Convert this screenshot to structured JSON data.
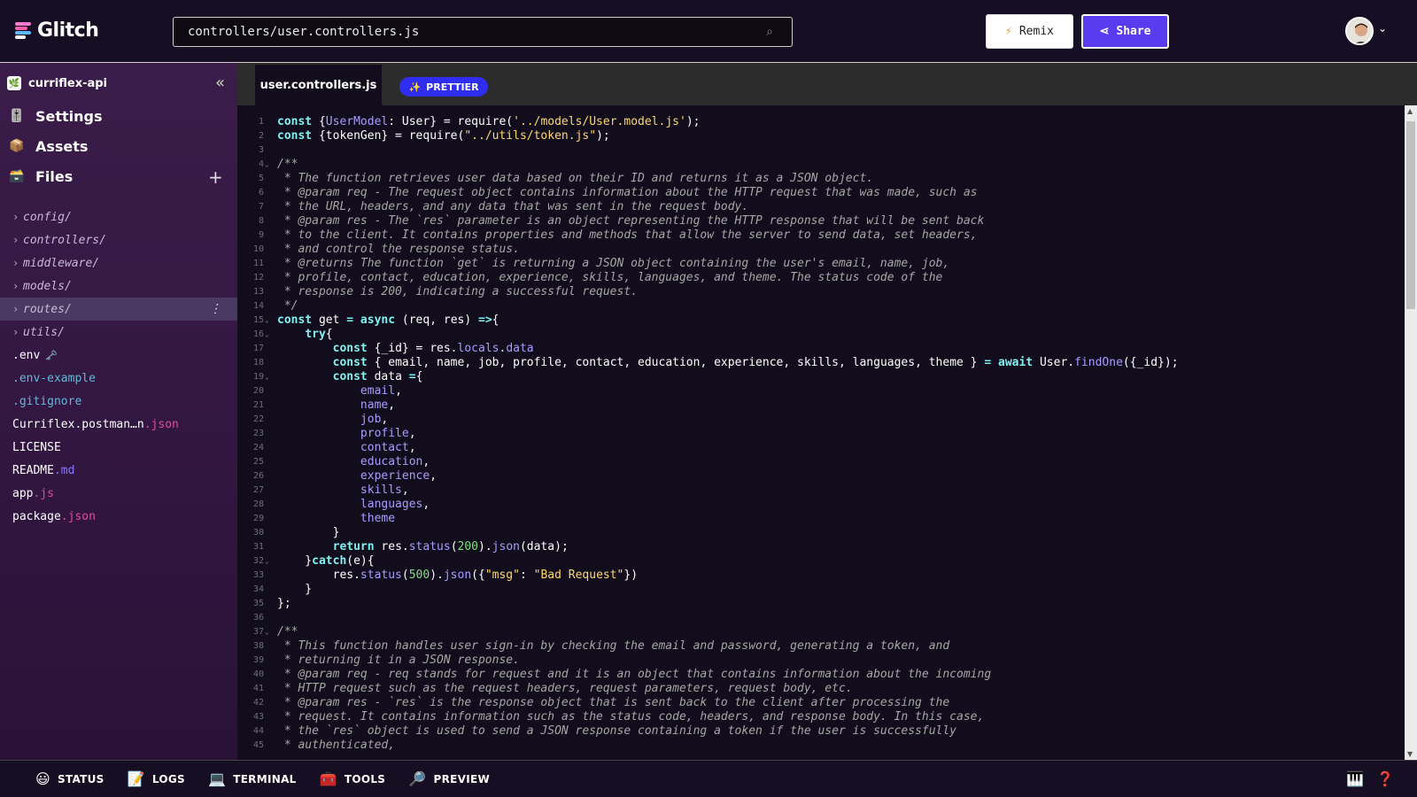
{
  "header": {
    "logo_text": "Glitch",
    "search_value": "controllers/user.controllers.js",
    "remix_label": "Remix",
    "share_label": "Share"
  },
  "sidebar": {
    "project_name": "curriflex-api",
    "nav": [
      {
        "label": "Settings",
        "icon": "settings-icon"
      },
      {
        "label": "Assets",
        "icon": "assets-icon"
      },
      {
        "label": "Files",
        "icon": "files-icon"
      }
    ],
    "files": [
      {
        "name": "config/",
        "type": "folder"
      },
      {
        "name": "controllers/",
        "type": "folder"
      },
      {
        "name": "middleware/",
        "type": "folder"
      },
      {
        "name": "models/",
        "type": "folder"
      },
      {
        "name": "routes/",
        "type": "folder",
        "selected": true
      },
      {
        "name": "utils/",
        "type": "folder"
      },
      {
        "name": ".env",
        "suffix": "🗝️",
        "type": "file"
      },
      {
        "name": ".env-example",
        "type": "file"
      },
      {
        "name": ".gitignore",
        "type": "file"
      },
      {
        "name": "Curriflex.postman…n",
        "ext": ".json",
        "type": "file"
      },
      {
        "name": "LICENSE",
        "type": "file"
      },
      {
        "name": "README",
        "ext": ".md",
        "type": "file"
      },
      {
        "name": "app",
        "ext": ".js",
        "type": "file"
      },
      {
        "name": "package",
        "ext": ".json",
        "type": "file"
      }
    ]
  },
  "editor": {
    "tab_label": "user.controllers.js",
    "prettier_label": "PRETTIER",
    "lines": [
      [
        [
          "kw",
          "const "
        ],
        [
          "pl",
          "{"
        ],
        [
          "prop",
          "UserModel"
        ],
        [
          "pl",
          ": User} = require("
        ],
        [
          "str",
          "'../models/User.model.js'"
        ],
        [
          "pl",
          ");"
        ]
      ],
      [
        [
          "kw",
          "const "
        ],
        [
          "pl",
          "{tokenGen} = require("
        ],
        [
          "str",
          "\"../utils/token.js\""
        ],
        [
          "pl",
          ");"
        ]
      ],
      [],
      [
        [
          "cm",
          "/**"
        ]
      ],
      [
        [
          "cm",
          " * The function retrieves user data based on their ID and returns it as a JSON object."
        ]
      ],
      [
        [
          "cm",
          " * @param req - The request object contains information about the HTTP request that was made, such as"
        ]
      ],
      [
        [
          "cm",
          " * the URL, headers, and any data that was sent in the request body."
        ]
      ],
      [
        [
          "cm",
          " * @param res - The `res` parameter is an object representing the HTTP response that will be sent back"
        ]
      ],
      [
        [
          "cm",
          " * to the client. It contains properties and methods that allow the server to send data, set headers,"
        ]
      ],
      [
        [
          "cm",
          " * and control the response status."
        ]
      ],
      [
        [
          "cm",
          " * @returns The function `get` is returning a JSON object containing the user's email, name, job,"
        ]
      ],
      [
        [
          "cm",
          " * profile, contact, education, experience, skills, languages, and theme. The status code of the"
        ]
      ],
      [
        [
          "cm",
          " * response is 200, indicating a successful request."
        ]
      ],
      [
        [
          "cm",
          " */"
        ]
      ],
      [
        [
          "kw",
          "const "
        ],
        [
          "pl",
          "get "
        ],
        [
          "kw",
          "= async "
        ],
        [
          "pl",
          "(req, res) "
        ],
        [
          "kw",
          "=>"
        ],
        [
          "pl",
          "{"
        ]
      ],
      [
        [
          "pl",
          "    "
        ],
        [
          "kw",
          "try"
        ],
        [
          "pl",
          "{"
        ]
      ],
      [
        [
          "pl",
          "        "
        ],
        [
          "kw",
          "const "
        ],
        [
          "pl",
          "{_id} = res."
        ],
        [
          "prop",
          "locals"
        ],
        [
          "pl",
          "."
        ],
        [
          "prop",
          "data"
        ]
      ],
      [
        [
          "pl",
          "        "
        ],
        [
          "kw",
          "const "
        ],
        [
          "pl",
          "{ email, name, job, profile, contact, education, experience, skills, languages, theme } "
        ],
        [
          "kw",
          "= await "
        ],
        [
          "pl",
          "User."
        ],
        [
          "prop",
          "findOne"
        ],
        [
          "pl",
          "({_id});"
        ]
      ],
      [
        [
          "pl",
          "        "
        ],
        [
          "kw",
          "const "
        ],
        [
          "pl",
          "data "
        ],
        [
          "kw",
          "="
        ],
        [
          "pl",
          "{"
        ]
      ],
      [
        [
          "pl",
          "            "
        ],
        [
          "prop",
          "email"
        ],
        [
          "pl",
          ","
        ]
      ],
      [
        [
          "pl",
          "            "
        ],
        [
          "prop",
          "name"
        ],
        [
          "pl",
          ","
        ]
      ],
      [
        [
          "pl",
          "            "
        ],
        [
          "prop",
          "job"
        ],
        [
          "pl",
          ","
        ]
      ],
      [
        [
          "pl",
          "            "
        ],
        [
          "prop",
          "profile"
        ],
        [
          "pl",
          ","
        ]
      ],
      [
        [
          "pl",
          "            "
        ],
        [
          "prop",
          "contact"
        ],
        [
          "pl",
          ","
        ]
      ],
      [
        [
          "pl",
          "            "
        ],
        [
          "prop",
          "education"
        ],
        [
          "pl",
          ","
        ]
      ],
      [
        [
          "pl",
          "            "
        ],
        [
          "prop",
          "experience"
        ],
        [
          "pl",
          ","
        ]
      ],
      [
        [
          "pl",
          "            "
        ],
        [
          "prop",
          "skills"
        ],
        [
          "pl",
          ","
        ]
      ],
      [
        [
          "pl",
          "            "
        ],
        [
          "prop",
          "languages"
        ],
        [
          "pl",
          ","
        ]
      ],
      [
        [
          "pl",
          "            "
        ],
        [
          "prop",
          "theme"
        ]
      ],
      [
        [
          "pl",
          "        }"
        ]
      ],
      [
        [
          "pl",
          "        "
        ],
        [
          "kw",
          "return "
        ],
        [
          "pl",
          "res."
        ],
        [
          "prop",
          "status"
        ],
        [
          "pl",
          "("
        ],
        [
          "num",
          "200"
        ],
        [
          "pl",
          ")."
        ],
        [
          "prop",
          "json"
        ],
        [
          "pl",
          "(data);"
        ]
      ],
      [
        [
          "pl",
          "    }"
        ],
        [
          "kw",
          "catch"
        ],
        [
          "pl",
          "(e){"
        ]
      ],
      [
        [
          "pl",
          "        res."
        ],
        [
          "prop",
          "status"
        ],
        [
          "pl",
          "("
        ],
        [
          "num",
          "500"
        ],
        [
          "pl",
          ")."
        ],
        [
          "prop",
          "json"
        ],
        [
          "pl",
          "({"
        ],
        [
          "str",
          "\"msg\""
        ],
        [
          "pl",
          ": "
        ],
        [
          "str",
          "\"Bad Request\""
        ],
        [
          "pl",
          "})"
        ]
      ],
      [
        [
          "pl",
          "    }"
        ]
      ],
      [
        [
          "pl",
          "};"
        ]
      ],
      [],
      [
        [
          "cm",
          "/**"
        ]
      ],
      [
        [
          "cm",
          " * This function handles user sign-in by checking the email and password, generating a token, and"
        ]
      ],
      [
        [
          "cm",
          " * returning it in a JSON response."
        ]
      ],
      [
        [
          "cm",
          " * @param req - req stands for request and it is an object that contains information about the incoming"
        ]
      ],
      [
        [
          "cm",
          " * HTTP request such as the request headers, request parameters, request body, etc."
        ]
      ],
      [
        [
          "cm",
          " * @param res - `res` is the response object that is sent back to the client after processing the"
        ]
      ],
      [
        [
          "cm",
          " * request. It contains information such as the status code, headers, and response body. In this case,"
        ]
      ],
      [
        [
          "cm",
          " * the `res` object is used to send a JSON response containing a token if the user is successfully"
        ]
      ],
      [
        [
          "cm",
          " * authenticated,"
        ]
      ]
    ],
    "fold_lines": [
      4,
      15,
      16,
      19,
      32,
      37
    ]
  },
  "bottombar": {
    "items": [
      {
        "label": "STATUS",
        "icon": "😃",
        "name": "status"
      },
      {
        "label": "LOGS",
        "icon": "📝",
        "name": "logs"
      },
      {
        "label": "TERMINAL",
        "icon": "💻",
        "name": "terminal"
      },
      {
        "label": "TOOLS",
        "icon": "🧰",
        "name": "tools"
      },
      {
        "label": "PREVIEW",
        "icon": "🔎",
        "name": "preview"
      }
    ],
    "keyboard_icon": "🎹",
    "help_icon": "❓"
  },
  "colors": {
    "accent": "#5a3cf0",
    "prettier": "#2e2df0"
  }
}
